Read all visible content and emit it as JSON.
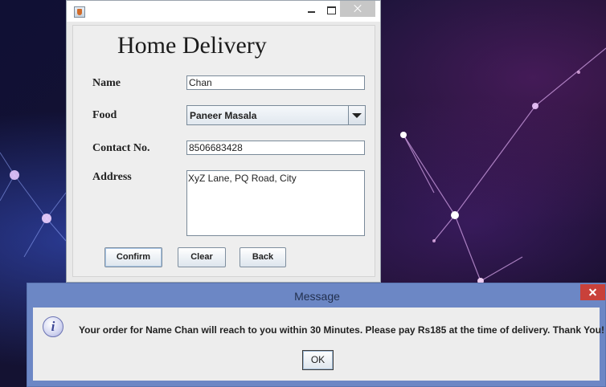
{
  "app": {
    "heading": "Home Delivery"
  },
  "form": {
    "name_label": "Name",
    "name_value": "Chan",
    "food_label": "Food",
    "food_value": "Paneer Masala",
    "contact_label": "Contact No.",
    "contact_value": "8506683428",
    "address_label": "Address",
    "address_value": "XyZ Lane, PQ Road, City"
  },
  "buttons": {
    "confirm": "Confirm",
    "clear": "Clear",
    "back": "Back"
  },
  "dialog": {
    "title": "Message",
    "message": "Your order for Name Chan will reach to you within 30 Minutes. Please pay Rs185 at the time of delivery. Thank You!",
    "ok": "OK"
  },
  "icons": {
    "app": "java-cup-icon",
    "info": "information-icon",
    "minimize": "minimize-icon",
    "maximize": "maximize-icon",
    "close": "close-icon",
    "dropdown": "chevron-down-icon"
  },
  "colors": {
    "dialog_frame": "#6c87c5",
    "dialog_close": "#c9413a",
    "window_bg": "#eeeeee"
  }
}
